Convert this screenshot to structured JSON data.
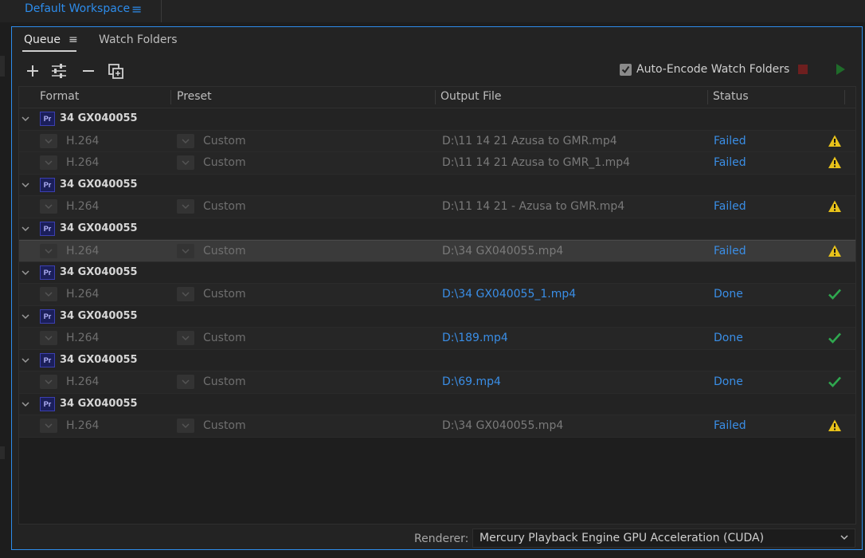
{
  "workspace": {
    "title": "Default Workspace",
    "menu_icon": "hamburger-icon"
  },
  "tabs": {
    "queue": "Queue",
    "watch_folders": "Watch Folders"
  },
  "toolbar": {
    "icons": [
      "add-icon",
      "settings-sliders-icon",
      "remove-icon",
      "duplicate-icon"
    ],
    "auto_encode_label": "Auto-Encode Watch Folders",
    "auto_encode_checked": true,
    "stop_color": "#6e1f1f",
    "play_color": "#1f6b2a"
  },
  "columns": {
    "format": "Format",
    "preset": "Preset",
    "output": "Output File",
    "status": "Status"
  },
  "colors": {
    "accent": "#2d8ceb",
    "failed_warning": "#e8c21a",
    "done_check": "#2fa84f"
  },
  "queue": [
    {
      "name": "34 GX040055",
      "badge": "Pr",
      "items": [
        {
          "format": "H.264",
          "preset": "Custom",
          "output": "D:\\11 14 21 Azusa to GMR.mp4",
          "status": "Failed"
        },
        {
          "format": "H.264",
          "preset": "Custom",
          "output": "D:\\11 14 21 Azusa to GMR_1.mp4",
          "status": "Failed"
        }
      ]
    },
    {
      "name": "34 GX040055",
      "badge": "Pr",
      "items": [
        {
          "format": "H.264",
          "preset": "Custom",
          "output": "D:\\11 14 21 - Azusa to GMR.mp4",
          "status": "Failed"
        }
      ]
    },
    {
      "name": "34 GX040055",
      "badge": "Pr",
      "items": [
        {
          "format": "H.264",
          "preset": "Custom",
          "output": "D:\\34 GX040055.mp4",
          "status": "Failed"
        }
      ]
    },
    {
      "name": "34 GX040055",
      "badge": "Pr",
      "items": [
        {
          "format": "H.264",
          "preset": "Custom",
          "output": "D:\\34 GX040055_1.mp4",
          "status": "Done"
        }
      ]
    },
    {
      "name": "34 GX040055",
      "badge": "Pr",
      "items": [
        {
          "format": "H.264",
          "preset": "Custom",
          "output": "D:\\189.mp4",
          "status": "Done"
        }
      ]
    },
    {
      "name": "34 GX040055",
      "badge": "Pr",
      "items": [
        {
          "format": "H.264",
          "preset": "Custom",
          "output": "D:\\69.mp4",
          "status": "Done"
        }
      ]
    },
    {
      "name": "34 GX040055",
      "badge": "Pr",
      "items": [
        {
          "format": "H.264",
          "preset": "Custom",
          "output": "D:\\34 GX040055.mp4",
          "status": "Failed"
        }
      ]
    }
  ],
  "footer": {
    "renderer_label": "Renderer:",
    "renderer_value": "Mercury Playback Engine GPU Acceleration (CUDA)"
  }
}
